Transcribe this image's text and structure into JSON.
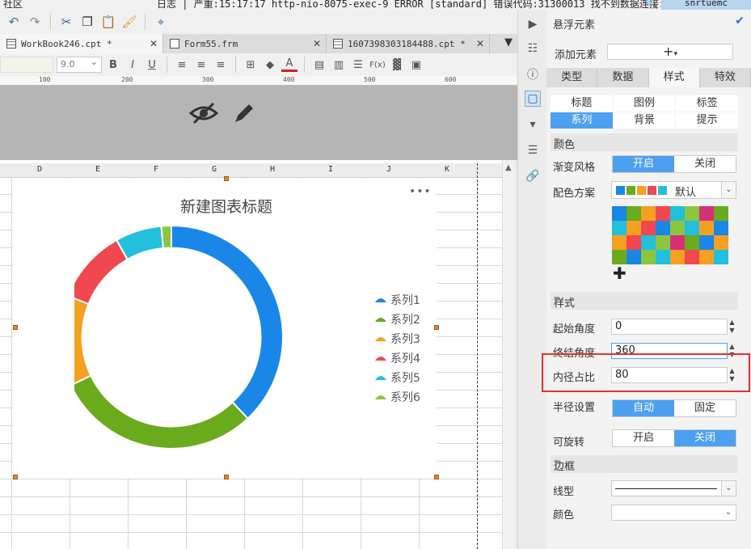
{
  "topbar": {
    "community": "社区",
    "log": "日志 | 严重:15:17:17 http-nio-8075-exec-9 ERROR [standard] 错误代码:31300013 找不到数据连接:ykzx",
    "user": "snrtuemc"
  },
  "tabs": [
    {
      "label": "WorkBook246.cpt *"
    },
    {
      "label": "Form55.frm"
    },
    {
      "label": "1607398303184488.cpt *"
    }
  ],
  "format": {
    "font_size": "9.0",
    "fx_label": "F(x)"
  },
  "ruler": {
    "marks": [
      "100",
      "200",
      "300",
      "400",
      "500",
      "600"
    ]
  },
  "sheet": {
    "columns": [
      "D",
      "E",
      "F",
      "G",
      "H",
      "I",
      "J",
      "K"
    ]
  },
  "chart": {
    "title": "新建图表标题",
    "menu": "•••",
    "legend": [
      "系列1",
      "系列2",
      "系列3",
      "系列4",
      "系列5",
      "系列6"
    ]
  },
  "chart_data": {
    "type": "pie",
    "categories": [
      "系列1",
      "系列2",
      "系列3",
      "系列4",
      "系列5",
      "系列6"
    ],
    "values": [
      36.7,
      28.9,
      12.7,
      10.4,
      6.5,
      1.4
    ],
    "colors": [
      "#1a86e8",
      "#6aab1e",
      "#f5a020",
      "#f0484e",
      "#22c0dc",
      "#8cc63f"
    ],
    "start_angle_deg": 0,
    "end_angle_deg": 360,
    "inner_radius_percent": 80,
    "title": "新建图表标题",
    "legend_position": "right"
  },
  "panel": {
    "title": "悬浮元素",
    "add_element_label": "添加元素",
    "add_symbol": "+",
    "main_tabs": [
      "类型",
      "数据",
      "样式",
      "特效"
    ],
    "active_main_tab": "样式",
    "sub_tabs": [
      "标题",
      "图例",
      "标签",
      "系列",
      "背景",
      "提示"
    ],
    "active_sub_tab": "系列",
    "section_color": "颜色",
    "gradient_label": "渐变风格",
    "on_label": "开启",
    "off_label": "关闭",
    "scheme_label": "配色方案",
    "scheme_value": "默认",
    "section_style": "样式",
    "start_angle_label": "起始角度",
    "start_angle_value": "0",
    "end_angle_label": "终结角度",
    "end_angle_value": "360",
    "inner_radius_label": "内径占比",
    "inner_radius_value": "80",
    "radius_label": "半径设置",
    "auto_label": "自动",
    "fixed_label": "固定",
    "rotate_label": "可旋转",
    "section_border": "边框",
    "line_type_label": "线型",
    "border_color_label": "颜色"
  },
  "palette_swatches": [
    "#1a86e8",
    "#6aab1e",
    "#f5a020",
    "#f0484e",
    "#22c0dc",
    "#8cc63f"
  ],
  "palette_grid": [
    "#1a86e8",
    "#6aab1e",
    "#f5a020",
    "#f0484e",
    "#22c0dc",
    "#8cc63f",
    "#d6307a",
    "#6aab1e",
    "#22c0dc",
    "#f5a020",
    "#f0484e",
    "#1a86e8",
    "#8cc63f",
    "#22c0dc",
    "#f5a020",
    "#1a86e8",
    "#f5a020",
    "#f0484e",
    "#22c0dc",
    "#8cc63f",
    "#d6307a",
    "#6aab1e",
    "#1a86e8",
    "#f5a020",
    "#6aab1e",
    "#1a86e8",
    "#8cc63f",
    "#22c0dc",
    "#f5a020",
    "#f0484e",
    "#f5a020",
    "#22c0dc"
  ]
}
